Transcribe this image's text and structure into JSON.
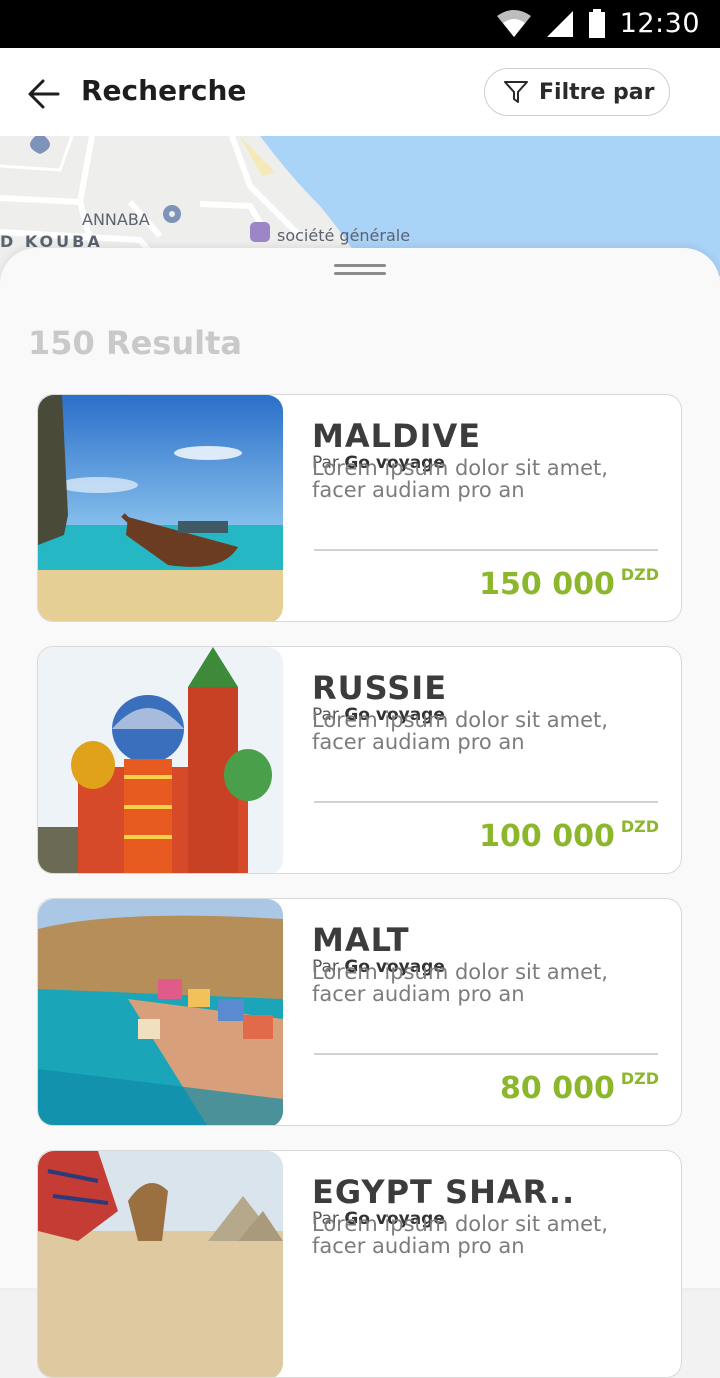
{
  "status_bar": {
    "time": "12:30"
  },
  "header": {
    "title": "Recherche",
    "filter_label": "Filtre par"
  },
  "map": {
    "labels": [
      "ANNABA",
      "D KOUBA",
      "société générale"
    ]
  },
  "results": {
    "count_label": "150 Resulta"
  },
  "colors": {
    "price": "#8cb72d",
    "title": "#3c3c3c",
    "sea": "#aad3f8"
  },
  "cards": [
    {
      "title": "MALDIVE",
      "by_prefix": "Par",
      "by_agency": "Go voyage",
      "description": "Lorem ipsum dolor sit amet, facer audiam pro an",
      "price": "150 000",
      "currency": "DZD"
    },
    {
      "title": "RUSSIE",
      "by_prefix": "Par",
      "by_agency": "Go voyage",
      "description": "Lorem ipsum dolor sit amet, facer audiam pro an",
      "price": "100 000",
      "currency": "DZD"
    },
    {
      "title": "MALT",
      "by_prefix": "Par",
      "by_agency": "Go voyage",
      "description": "Lorem ipsum dolor sit amet, facer audiam pro an",
      "price": "80 000",
      "currency": "DZD"
    },
    {
      "title": "EGYPT SHAR..",
      "by_prefix": "Par",
      "by_agency": "Go voyage",
      "description": "Lorem ipsum dolor sit amet, facer audiam pro an",
      "price": "",
      "currency": ""
    }
  ]
}
